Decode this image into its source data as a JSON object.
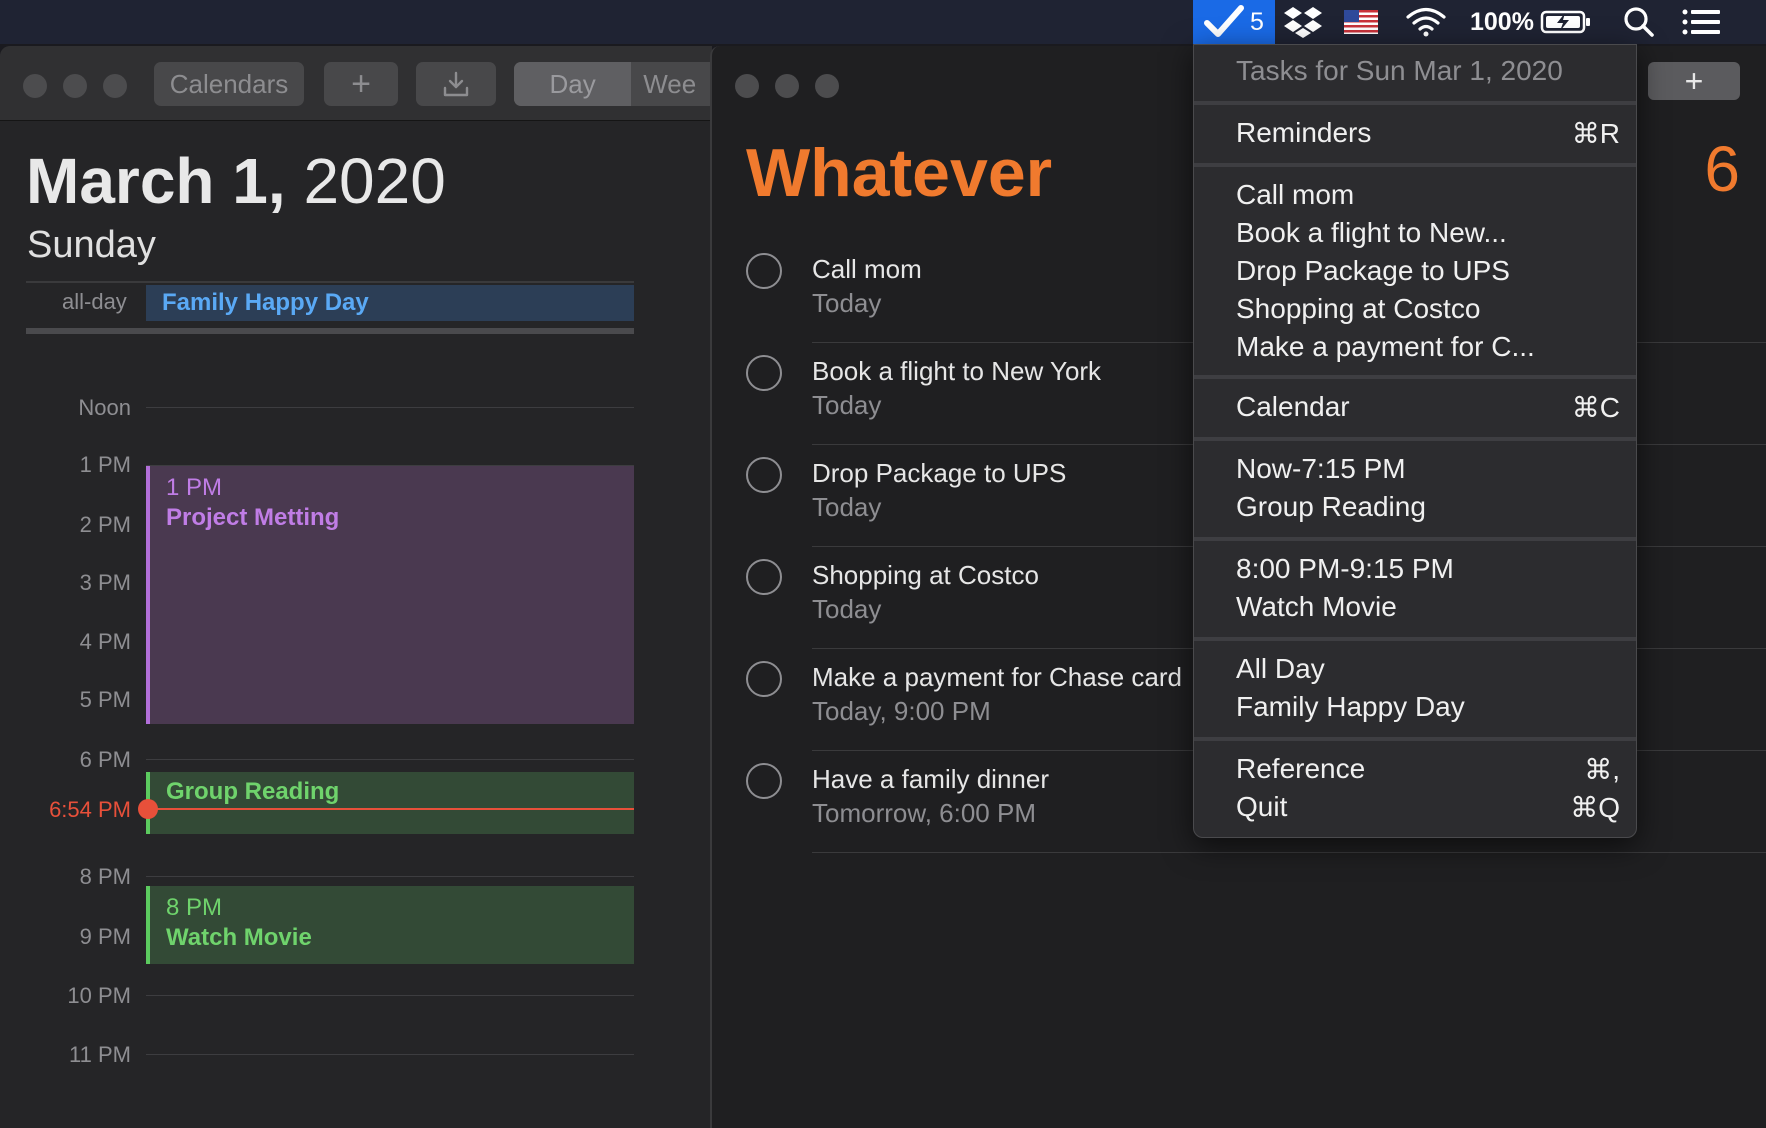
{
  "menubar": {
    "task_count": "5",
    "battery": "100%"
  },
  "calendar": {
    "toolbar": {
      "calendars_label": "Calendars",
      "add_label": "+",
      "day_label": "Day",
      "week_label": "Wee"
    },
    "date_bold": "March 1,",
    "year": "2020",
    "weekday": "Sunday",
    "allday_label": "all-day",
    "allday_event": "Family Happy Day",
    "hours": [
      "Noon",
      "1 PM",
      "2 PM",
      "3 PM",
      "4 PM",
      "5 PM",
      "6 PM",
      "8 PM",
      "9 PM",
      "10 PM",
      "11 PM"
    ],
    "now_label": "6:54 PM",
    "events": {
      "project": {
        "time": "1 PM",
        "title": "Project Metting"
      },
      "reading": {
        "title": "Group Reading"
      },
      "movie": {
        "time": "8 PM",
        "title": "Watch Movie"
      }
    }
  },
  "reminders": {
    "list_title": "Whatever",
    "count": "6",
    "add_label": "+",
    "tasks": [
      {
        "name": "Call mom",
        "due": "Today"
      },
      {
        "name": "Book a flight to New York",
        "due": "Today"
      },
      {
        "name": "Drop Package to UPS",
        "due": "Today"
      },
      {
        "name": "Shopping at Costco",
        "due": "Today"
      },
      {
        "name": "Make a payment for Chase card",
        "due": "Today, 9:00 PM"
      },
      {
        "name": "Have a family dinner",
        "due": "Tomorrow, 6:00 PM"
      }
    ]
  },
  "menu": {
    "header": "Tasks for Sun Mar 1, 2020",
    "reminders": {
      "label": "Reminders",
      "shortcut": "⌘R"
    },
    "tasks": [
      "Call mom",
      "Book a flight to New...",
      "Drop Package to UPS",
      "Shopping at Costco",
      "Make a payment for C..."
    ],
    "calendar": {
      "label": "Calendar",
      "shortcut": "⌘C"
    },
    "event1": {
      "time": "Now-7:15 PM",
      "title": "Group Reading"
    },
    "event2": {
      "time": "8:00 PM-9:15 PM",
      "title": "Watch Movie"
    },
    "event3": {
      "time": "All Day",
      "title": "Family Happy Day"
    },
    "reference": {
      "label": "Reference",
      "shortcut": "⌘,"
    },
    "quit": {
      "label": "Quit",
      "shortcut": "⌘Q"
    }
  },
  "colors": {
    "accent_orange": "#f07a2e",
    "menubar_highlight": "#1a6ae6",
    "event_purple": "#b26fd9",
    "event_green": "#5ccb5f",
    "allday_blue": "#5aa9f5",
    "now_red": "#e8503a"
  },
  "icons": [
    "checkmark-icon",
    "dropbox-icon",
    "us-flag-icon",
    "wifi-icon",
    "battery-charging-icon",
    "search-icon",
    "list-icon",
    "download-icon"
  ]
}
